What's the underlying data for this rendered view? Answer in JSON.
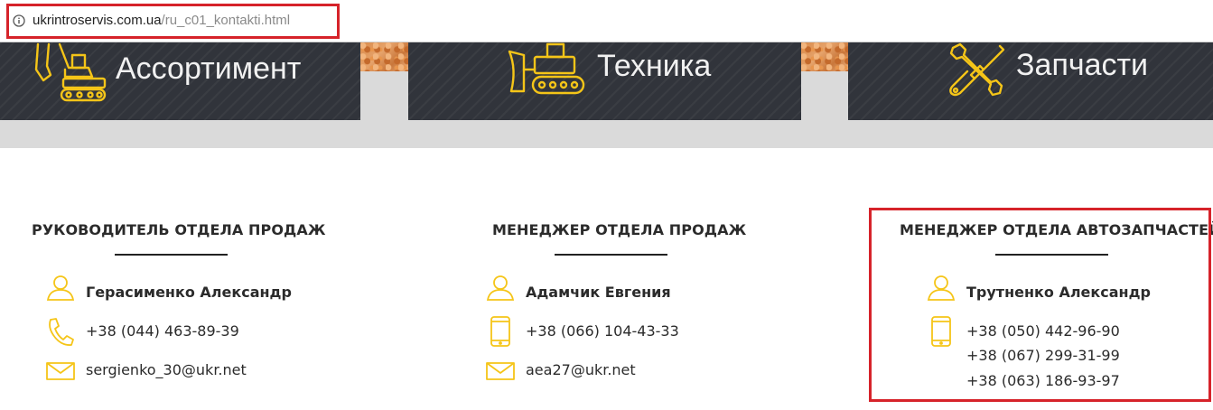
{
  "browser": {
    "url_host": "ukrintroservis.com.ua",
    "url_path": "/ru_c01_kontakti.html"
  },
  "nav": {
    "items": [
      {
        "label": "Ассортимент",
        "icon": "excavator-icon"
      },
      {
        "label": "Техника",
        "icon": "bulldozer-icon"
      },
      {
        "label": "Запчасти",
        "icon": "wrench-screwdriver-icon"
      }
    ]
  },
  "contacts": [
    {
      "title": "РУКОВОДИТЕЛЬ ОТДЕЛА ПРОДАЖ",
      "name": "Герасименко Александр",
      "phones": [
        "+38 (044) 463-89-39"
      ],
      "email": "sergienko_30@ukr.net",
      "phone_icon": "handset-icon"
    },
    {
      "title": "МЕНЕДЖЕР ОТДЕЛА ПРОДАЖ",
      "name": "Адамчик Евгения",
      "phones": [
        "+38 (066) 104-43-33"
      ],
      "email": "aea27@ukr.net",
      "phone_icon": "mobile-phone-icon"
    },
    {
      "title": "МЕНЕДЖЕР ОТДЕЛА АВТОЗАПЧАСТЕЙ",
      "name": "Трутненко Александр",
      "phones": [
        "+38 (050) 442-96-90",
        "+38 (067) 299-31-99",
        "+38 (063) 186-93-97"
      ],
      "phone_icon": "mobile-phone-icon"
    }
  ],
  "colors": {
    "accent": "#f5c518",
    "highlight_box": "#d6232a",
    "nav_panel": "#31343b"
  }
}
